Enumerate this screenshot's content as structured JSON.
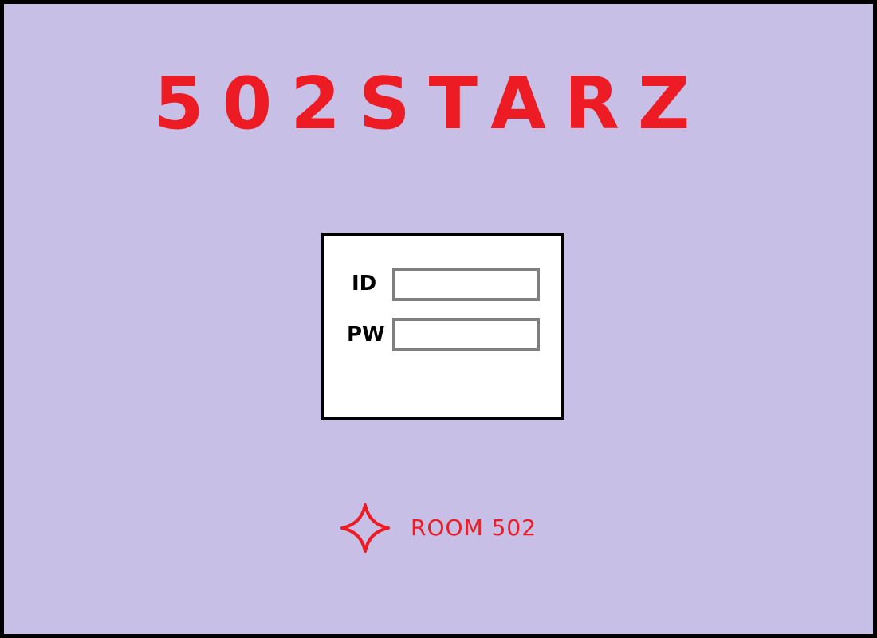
{
  "app": {
    "title": "502STARZ"
  },
  "login": {
    "id_label": "ID",
    "id_value": "",
    "pw_label": "PW",
    "pw_value": ""
  },
  "footer": {
    "icon": "four-point-star-icon",
    "label": "ROOM 502"
  },
  "colors": {
    "background": "#c8bfe7",
    "accent": "#ed1c24",
    "panel": "#ffffff",
    "input_border": "#7f7f7f",
    "frame_border": "#000000"
  }
}
